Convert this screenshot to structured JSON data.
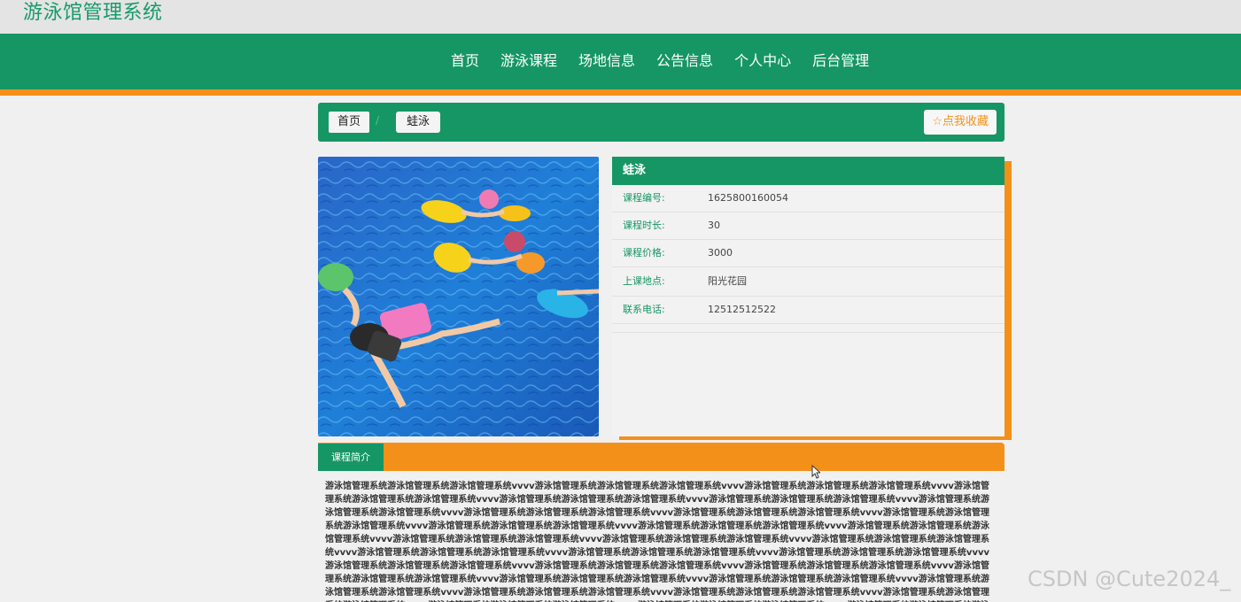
{
  "site": {
    "title": "游泳馆管理系统"
  },
  "nav": {
    "items": [
      {
        "label": "首页"
      },
      {
        "label": "游泳课程"
      },
      {
        "label": "场地信息"
      },
      {
        "label": "公告信息"
      },
      {
        "label": "个人中心"
      },
      {
        "label": "后台管理"
      }
    ]
  },
  "breadcrumb": {
    "home": "首页",
    "separator": "/",
    "current": "蛙泳"
  },
  "favorite": {
    "label": "☆点我收藏"
  },
  "course": {
    "name": "蛙泳",
    "fields": [
      {
        "label": "课程编号:",
        "value": "1625800160054"
      },
      {
        "label": "课程时长:",
        "value": "30"
      },
      {
        "label": "课程价格:",
        "value": "3000"
      },
      {
        "label": "上课地点:",
        "value": "阳光花园"
      },
      {
        "label": "联系电话:",
        "value": "12512512522"
      }
    ]
  },
  "intro": {
    "tab_label": "课程简介",
    "text": "游泳馆管理系统游泳馆管理系统游泳馆管理系统vvvv游泳馆管理系统游泳馆管理系统游泳馆管理系统vvvv游泳馆管理系统游泳馆管理系统游泳馆管理系统vvvv游泳馆管理系统游泳馆管理系统游泳馆管理系统vvvv游泳馆管理系统游泳馆管理系统游泳馆管理系统vvvv游泳馆管理系统游泳馆管理系统游泳馆管理系统vvvv游泳馆管理系统游泳馆管理系统游泳馆管理系统vvvv游泳馆管理系统游泳馆管理系统游泳馆管理系统vvvv游泳馆管理系统游泳馆管理系统游泳馆管理系统vvvv游泳馆管理系统游泳馆管理系统游泳馆管理系统vvvv游泳馆管理系统游泳馆管理系统游泳馆管理系统vvvv游泳馆管理系统游泳馆管理系统游泳馆管理系统vvvv游泳馆管理系统游泳馆管理系统游泳馆管理系统vvvv游泳馆管理系统游泳馆管理系统游泳馆管理系统vvvv游泳馆管理系统游泳馆管理系统游泳馆管理系统vvvv游泳馆管理系统游泳馆管理系统游泳馆管理系统vvvv游泳馆管理系统游泳馆管理系统游泳馆管理系统vvvv游泳馆管理系统游泳馆管理系统游泳馆管理系统vvvv游泳馆管理系统游泳馆管理系统游泳馆管理系统vvvv游泳馆管理系统游泳馆管理系统游泳馆管理系统vvvv游泳馆管理系统游泳馆管理系统游泳馆管理系统vvvv游泳馆管理系统游泳馆管理系统游泳馆管理系统vvvv游泳馆管理系统游泳馆管理系统游泳馆管理系统vvvv游泳馆管理系统游泳馆管理系统游泳馆管理系统vvvv游泳馆管理系统游泳馆管理系统游泳馆管理系统vvvv游泳馆管理系统游泳馆管理系统游泳馆管理系统vvvv游泳馆管理系统游泳馆管理系统游泳馆管理系统vvvv游泳馆管理系统游泳馆管理系统游泳馆管理系统vvvv游泳馆管理系统游泳馆管理系统游泳馆管理系统vvvv游泳馆管理系统游泳馆管理系统游泳馆管理系统vvvv游泳馆管理系统游泳馆管理系统游泳馆管理系统vvvv游泳馆管理系统游泳馆管理系统游泳馆管理系统vvvv"
  },
  "watermark": {
    "text": "CSDN @Cute2024_"
  },
  "colors": {
    "primary": "#169664",
    "accent": "#f39019",
    "title": "#169b6b"
  },
  "icons": {
    "favorite": "star-icon",
    "cursor": "mouse-pointer-icon"
  }
}
